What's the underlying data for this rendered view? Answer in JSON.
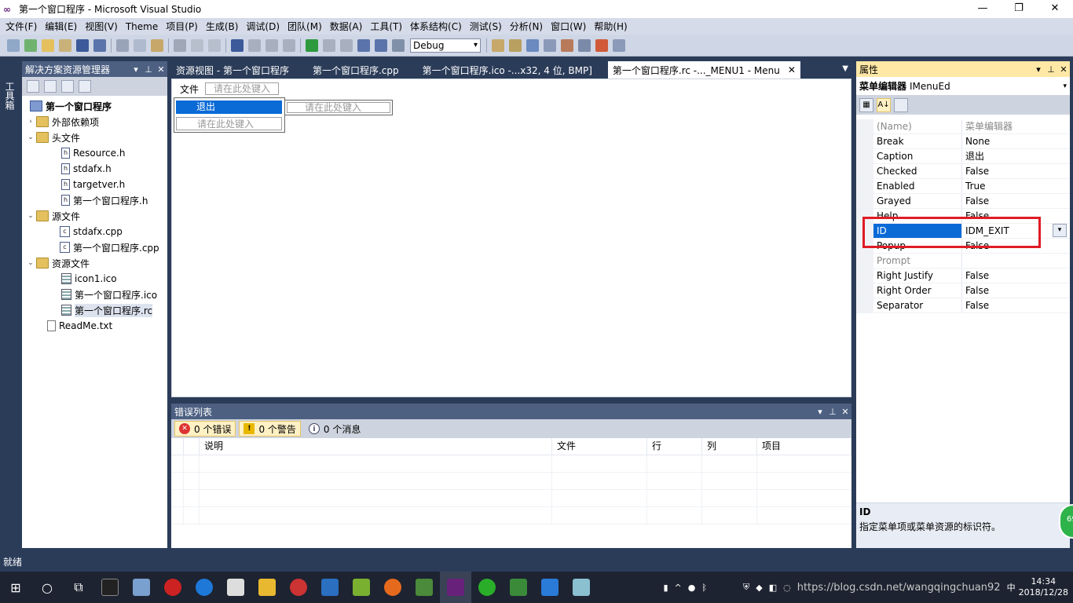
{
  "window": {
    "title": "第一个窗口程序 - Microsoft Visual Studio"
  },
  "menu": [
    "文件(F)",
    "编辑(E)",
    "视图(V)",
    "Theme",
    "项目(P)",
    "生成(B)",
    "调试(D)",
    "团队(M)",
    "数据(A)",
    "工具(T)",
    "体系结构(C)",
    "测试(S)",
    "分析(N)",
    "窗口(W)",
    "帮助(H)"
  ],
  "toolbar": {
    "config": "Debug"
  },
  "toolbox": {
    "label": "工具箱"
  },
  "solution": {
    "title": "解决方案资源管理器",
    "nodes": [
      {
        "label": "第一个窗口程序",
        "icon": "project-icon"
      },
      {
        "label": "外部依赖项",
        "icon": "folder-icon"
      },
      {
        "label": "头文件",
        "icon": "folder-icon"
      },
      {
        "label": "Resource.h",
        "icon": "header-file-icon"
      },
      {
        "label": "stdafx.h",
        "icon": "header-file-icon"
      },
      {
        "label": "targetver.h",
        "icon": "header-file-icon"
      },
      {
        "label": "第一个窗口程序.h",
        "icon": "header-file-icon"
      },
      {
        "label": "源文件",
        "icon": "folder-icon"
      },
      {
        "label": "stdafx.cpp",
        "icon": "cpp-file-icon"
      },
      {
        "label": "第一个窗口程序.cpp",
        "icon": "cpp-file-icon"
      },
      {
        "label": "资源文件",
        "icon": "folder-icon"
      },
      {
        "label": "icon1.ico",
        "icon": "ico-file-icon"
      },
      {
        "label": "第一个窗口程序.ico",
        "icon": "ico-file-icon"
      },
      {
        "label": "第一个窗口程序.rc",
        "icon": "rc-file-icon"
      },
      {
        "label": "ReadMe.txt",
        "icon": "text-file-icon"
      }
    ]
  },
  "tabs": [
    "资源视图 - 第一个窗口程序",
    "第一个窗口程序.cpp",
    "第一个窗口程序.ico -...x32, 4 位, BMP]",
    "第一个窗口程序.rc -..._MENU1 - Menu"
  ],
  "menu_editor": {
    "top_item": "文件",
    "placeholder": "请在此处键入",
    "selected_item": "退出"
  },
  "errors": {
    "title": "错误列表",
    "errors_btn": "0 个错误",
    "warnings_btn": "0 个警告",
    "messages_btn": "0 个消息",
    "columns": [
      "说明",
      "文件",
      "行",
      "列",
      "项目"
    ]
  },
  "properties": {
    "title": "属性",
    "object_name": "菜单编辑器",
    "object_type": "IMenuEd",
    "rows": [
      {
        "name": "(Name)",
        "value": "菜单编辑器"
      },
      {
        "name": "Break",
        "value": "None"
      },
      {
        "name": "Caption",
        "value": "退出"
      },
      {
        "name": "Checked",
        "value": "False"
      },
      {
        "name": "Enabled",
        "value": "True"
      },
      {
        "name": "Grayed",
        "value": "False"
      },
      {
        "name": "Help",
        "value": "False"
      },
      {
        "name": "ID",
        "value": "IDM_EXIT"
      },
      {
        "name": "Popup",
        "value": "False"
      },
      {
        "name": "Prompt",
        "value": ""
      },
      {
        "name": "Right Justify",
        "value": "False"
      },
      {
        "name": "Right Order",
        "value": "False"
      },
      {
        "name": "Separator",
        "value": "False"
      }
    ],
    "desc_title": "ID",
    "desc_text": "指定菜单项或菜单资源的标识符。",
    "badge": "69"
  },
  "status": {
    "text": "就绪"
  },
  "taskbar": {
    "time": "14:34",
    "date": "2018/12/28",
    "watermark": "https://blog.csdn.net/wangqingchuan92",
    "ime": "中"
  },
  "colors": {
    "accent": "#0a6ad6",
    "chrome": "#2b3c59",
    "highlight": "#e01b24"
  }
}
